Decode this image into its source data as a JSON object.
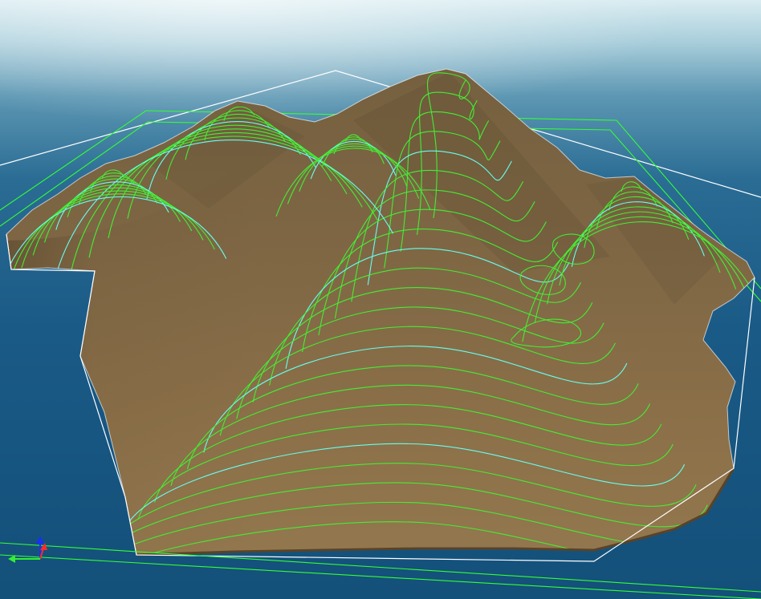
{
  "viewport": {
    "view": "3d-perspective",
    "sky_color": "#cfe6ee",
    "water_color": "#15507c",
    "terrain_color": "#7f6645",
    "selection_box_color": "#ffffff",
    "region_box_color": "#33ff33",
    "contour_color": "#44ee33",
    "index_contour_color": "#66ffee"
  },
  "gizmo": {
    "axes": [
      {
        "name": "z",
        "color": "#1a2dff"
      },
      {
        "name": "x",
        "color": "#ff2a2a"
      },
      {
        "name": "y",
        "color": "#33ee33"
      }
    ]
  }
}
